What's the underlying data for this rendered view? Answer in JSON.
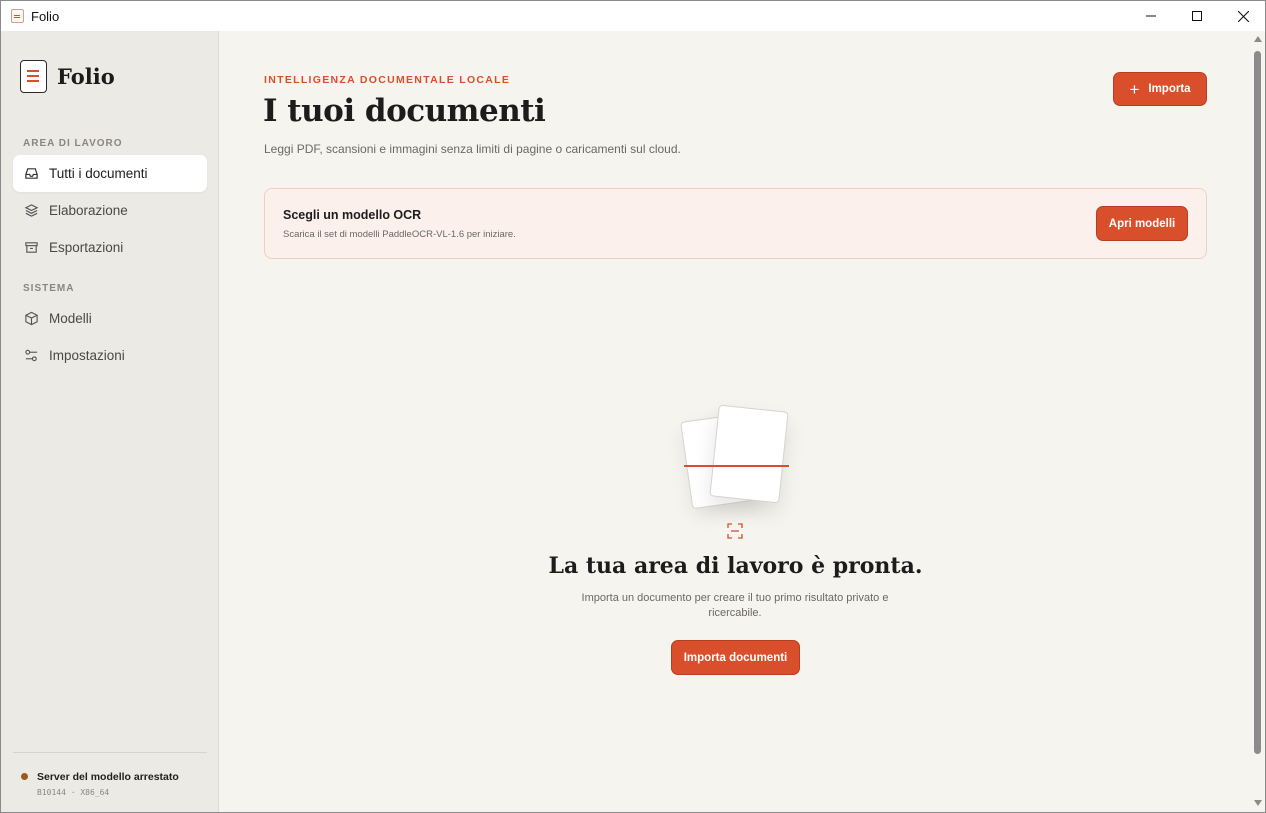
{
  "window": {
    "title": "Folio"
  },
  "sidebar": {
    "brand": "Folio",
    "sections": [
      {
        "label": "AREA DI LAVORO",
        "items": [
          {
            "label": "Tutti i documenti",
            "icon": "inbox-icon",
            "active": true
          },
          {
            "label": "Elaborazione",
            "icon": "layers-icon",
            "active": false
          },
          {
            "label": "Esportazioni",
            "icon": "archive-icon",
            "active": false
          }
        ]
      },
      {
        "label": "SISTEMA",
        "items": [
          {
            "label": "Modelli",
            "icon": "cube-icon",
            "active": false
          },
          {
            "label": "Impostazioni",
            "icon": "sliders-icon",
            "active": false
          }
        ]
      }
    ],
    "status": {
      "text": "Server del modello arrestato",
      "detail": "B10144 · X86_64",
      "color": "#9a5a1c"
    }
  },
  "main": {
    "eyebrow": "INTELLIGENZA DOCUMENTALE LOCALE",
    "title": "I tuoi documenti",
    "subtitle": "Leggi PDF, scansioni e immagini senza limiti di pagine o caricamenti sul cloud.",
    "import_label": "Importa",
    "banner": {
      "title": "Scegli un modello OCR",
      "subtitle": "Scarica il set di modelli PaddleOCR-VL-1.6 per iniziare.",
      "button": "Apri modelli"
    },
    "empty_state": {
      "title": "La tua area di lavoro è pronta.",
      "subtitle": "Importa un documento per creare il tuo primo risultato privato e ricercabile.",
      "button": "Importa documenti"
    }
  },
  "colors": {
    "accent": "#d94f2b",
    "sidebar_bg": "#ebeae4",
    "main_bg": "#f5f4ef",
    "banner_bg": "#fbf0eb"
  }
}
